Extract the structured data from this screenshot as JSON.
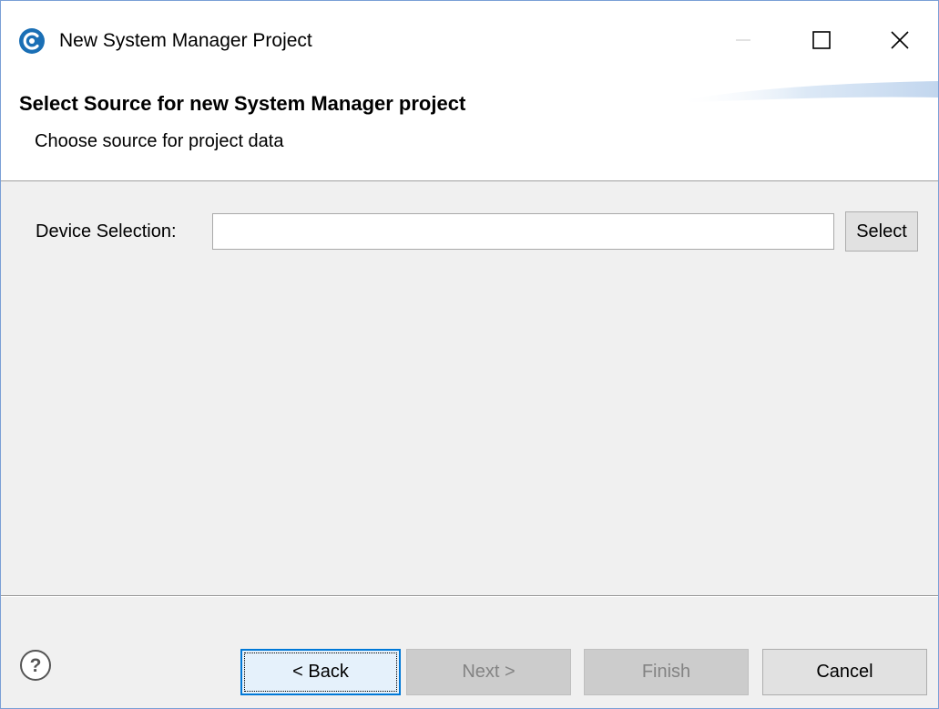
{
  "window": {
    "title": "New System Manager Project"
  },
  "header": {
    "title": "Select Source for new System Manager project",
    "description": "Choose source for project data"
  },
  "form": {
    "device_selection_label": "Device Selection:",
    "device_selection_value": "",
    "select_button_label": "Select"
  },
  "footer": {
    "back_label": "< Back",
    "next_label": "Next >",
    "finish_label": "Finish",
    "cancel_label": "Cancel"
  },
  "icons": {
    "app": "app-logo-icon",
    "minimize": "minimize-icon",
    "maximize": "maximize-icon",
    "close": "close-icon",
    "help": "help-icon"
  },
  "colors": {
    "accent": "#0078d7",
    "app_icon": "#1a6fb5",
    "disabled_text": "#838383"
  }
}
